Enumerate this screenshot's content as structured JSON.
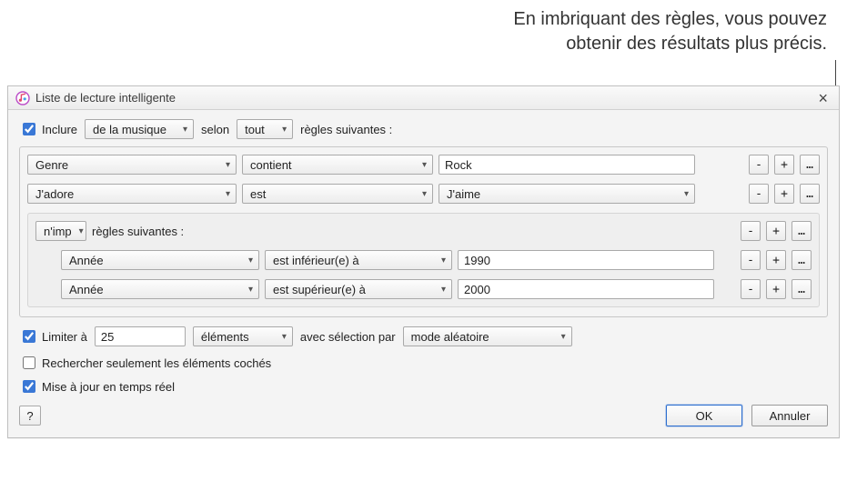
{
  "annotation": {
    "line1": "En imbriquant des règles, vous pouvez",
    "line2": "obtenir des résultats plus précis."
  },
  "dialog": {
    "title": "Liste de lecture intelligente"
  },
  "match": {
    "include_label": "Inclure",
    "media": "de la musique",
    "selon": "selon",
    "any": "tout",
    "suffix": "règles suivantes :"
  },
  "rules": [
    {
      "field": "Genre",
      "op": "contient",
      "value": "Rock",
      "value_is_select": false
    },
    {
      "field": "J'adore",
      "op": "est",
      "value": "J'aime",
      "value_is_select": true
    }
  ],
  "nested": {
    "match": "n'imp",
    "suffix": "règles suivantes :",
    "rules": [
      {
        "field": "Année",
        "op": "est inférieur(e) à",
        "value": "1990"
      },
      {
        "field": "Année",
        "op": "est supérieur(e) à",
        "value": "2000"
      }
    ]
  },
  "limit": {
    "label": "Limiter à",
    "value": "25",
    "unit": "éléments",
    "selected_by_label": "avec sélection par",
    "mode": "mode aléatoire"
  },
  "checked_only": "Rechercher seulement les éléments cochés",
  "live_update": "Mise à jour en temps réel",
  "buttons": {
    "ok": "OK",
    "cancel": "Annuler",
    "help": "?",
    "minus": "-",
    "plus": "+",
    "more": "…"
  }
}
